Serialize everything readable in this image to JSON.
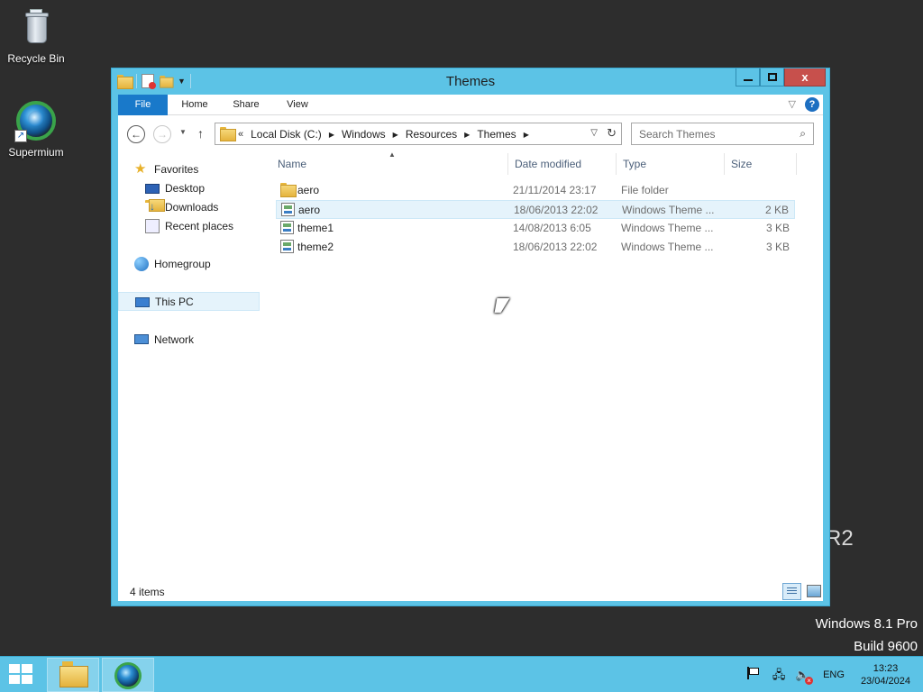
{
  "desktop": {
    "icons": [
      {
        "label": "Recycle Bin",
        "icon": "recycle-bin-icon"
      },
      {
        "label": "Supermium",
        "icon": "supermium-browser-icon"
      }
    ],
    "watermark": {
      "edition": "Windows 8.1 Pro",
      "build": "Build 9600",
      "partial": "R2"
    }
  },
  "window": {
    "title": "Themes",
    "caption": {
      "minimize": "minimize",
      "maximize": "maximize",
      "close": "x"
    },
    "ribbon_tabs": [
      "File",
      "Home",
      "Share",
      "View"
    ],
    "address": {
      "overflow": "«",
      "breadcrumbs": [
        "Local Disk (C:)",
        "Windows",
        "Resources",
        "Themes"
      ]
    },
    "search": {
      "placeholder": "Search Themes"
    },
    "nav_pane": {
      "favorites": "Favorites",
      "favorites_items": [
        "Desktop",
        "Downloads",
        "Recent places"
      ],
      "homegroup": "Homegroup",
      "this_pc": "This PC",
      "network": "Network"
    },
    "columns": {
      "name": "Name",
      "date": "Date modified",
      "type": "Type",
      "size": "Size"
    },
    "files": [
      {
        "name": "aero",
        "date": "21/11/2014 23:17",
        "type": "File folder",
        "size": "",
        "icon": "folder-icon"
      },
      {
        "name": "aero",
        "date": "18/06/2013 22:02",
        "type": "Windows Theme ...",
        "size": "2 KB",
        "icon": "theme-file-icon"
      },
      {
        "name": "theme1",
        "date": "14/08/2013 6:05",
        "type": "Windows Theme ...",
        "size": "3 KB",
        "icon": "theme-file-icon"
      },
      {
        "name": "theme2",
        "date": "18/06/2013 22:02",
        "type": "Windows Theme ...",
        "size": "3 KB",
        "icon": "theme-file-icon"
      }
    ],
    "status": {
      "item_count": "4 items"
    }
  },
  "taskbar": {
    "tray": {
      "language": "ENG",
      "time": "13:23",
      "date": "23/04/2024"
    }
  },
  "colors": {
    "window_frame": "#5cc3e6",
    "file_tab": "#1979ca",
    "close_button": "#c7504c",
    "desktop": "#2d2d2d",
    "selection": "#e5f3fb"
  }
}
